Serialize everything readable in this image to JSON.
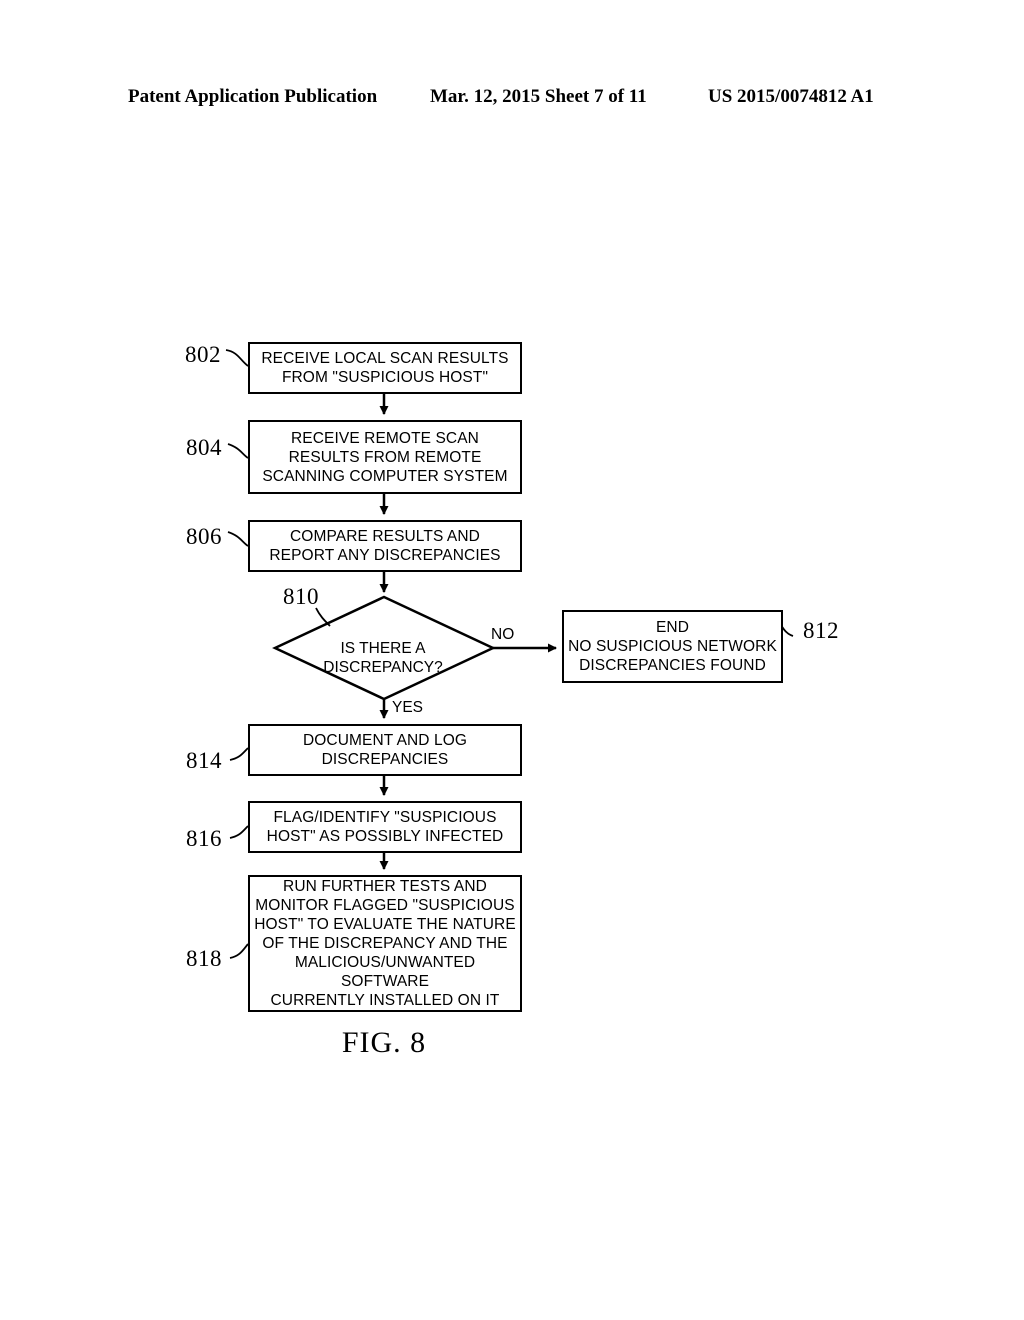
{
  "header": {
    "left": "Patent Application Publication",
    "middle": "Mar. 12, 2015  Sheet 7 of 11",
    "right": "US 2015/0074812 A1"
  },
  "figure": {
    "caption": "FIG. 8"
  },
  "flowchart": {
    "nodes": [
      {
        "ref": "802",
        "kind": "process",
        "text": "RECEIVE LOCAL SCAN RESULTS\nFROM \"SUSPICIOUS HOST\""
      },
      {
        "ref": "804",
        "kind": "process",
        "text": "RECEIVE REMOTE SCAN\nRESULTS FROM REMOTE\nSCANNING COMPUTER SYSTEM"
      },
      {
        "ref": "806",
        "kind": "process",
        "text": "COMPARE RESULTS AND\nREPORT ANY DISCREPANCIES"
      },
      {
        "ref": "810",
        "kind": "decision",
        "text": "IS THERE A\nDISCREPANCY?"
      },
      {
        "ref": "812",
        "kind": "terminator",
        "text": "END\nNO SUSPICIOUS NETWORK\nDISCREPANCIES FOUND"
      },
      {
        "ref": "814",
        "kind": "process",
        "text": "DOCUMENT AND LOG\nDISCREPANCIES"
      },
      {
        "ref": "816",
        "kind": "process",
        "text": "FLAG/IDENTIFY \"SUSPICIOUS\nHOST\" AS POSSIBLY INFECTED"
      },
      {
        "ref": "818",
        "kind": "process",
        "text": "RUN FURTHER TESTS AND\nMONITOR FLAGGED \"SUSPICIOUS\nHOST\" TO EVALUATE THE NATURE\nOF THE DISCREPANCY AND THE\nMALICIOUS/UNWANTED SOFTWARE\nCURRENTLY INSTALLED ON IT"
      }
    ],
    "branch_labels": {
      "no": "NO",
      "yes": "YES"
    },
    "line_color": "#000000",
    "fill_color": "#ffffff"
  }
}
